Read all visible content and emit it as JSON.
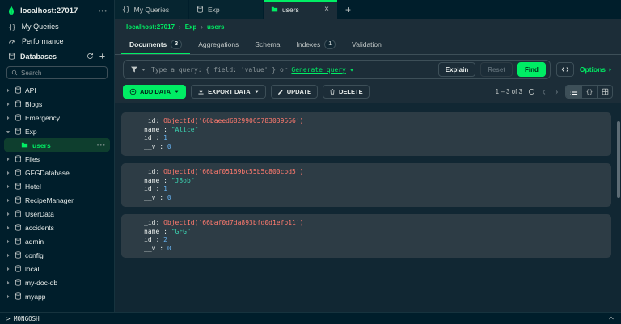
{
  "colors": {
    "accent": "#00ED64",
    "objectid_value": "#FF7A6E",
    "string_value": "#3BD2B0",
    "number_value": "#66B2F0"
  },
  "sidebar": {
    "host": "localhost:27017",
    "menu_dots": "•••",
    "nav": [
      {
        "label": "My Queries"
      },
      {
        "label": "Performance"
      }
    ],
    "databases_label": "Databases",
    "search_placeholder": "Search",
    "databases": [
      {
        "label": "API"
      },
      {
        "label": "Blogs"
      },
      {
        "label": "Emergency"
      },
      {
        "label": "Exp",
        "expanded": true,
        "children": [
          {
            "label": "users",
            "active": true
          }
        ]
      },
      {
        "label": "Files"
      },
      {
        "label": "GFGDatabase"
      },
      {
        "label": "Hotel"
      },
      {
        "label": "RecipeManager"
      },
      {
        "label": "UserData"
      },
      {
        "label": "accidents"
      },
      {
        "label": "admin"
      },
      {
        "label": "config"
      },
      {
        "label": "local"
      },
      {
        "label": "my-doc-db"
      },
      {
        "label": "myapp"
      }
    ]
  },
  "tabbar": {
    "tabs": [
      {
        "label": "My Queries",
        "active": false
      },
      {
        "label": "Exp",
        "active": false
      },
      {
        "label": "users",
        "active": true
      }
    ],
    "new_tab": "+"
  },
  "breadcrumb": {
    "items": [
      "localhost:27017",
      "Exp",
      "users"
    ]
  },
  "subtabs": [
    {
      "label": "Documents",
      "count": "3",
      "active": true
    },
    {
      "label": "Aggregations"
    },
    {
      "label": "Schema"
    },
    {
      "label": "Indexes",
      "count": "1"
    },
    {
      "label": "Validation"
    }
  ],
  "query_bar": {
    "placeholder": "Type a query: { field: 'value' } or",
    "generate_link": "Generate query",
    "explain": "Explain",
    "reset": "Reset",
    "find": "Find",
    "options": "Options"
  },
  "toolbar": {
    "add_data": "ADD DATA",
    "export_data": "EXPORT DATA",
    "update": "UPDATE",
    "delete": "DELETE",
    "pagination": "1 – 3 of 3"
  },
  "documents": [
    {
      "fields": [
        {
          "key": "_id",
          "sep": ": ",
          "value": "ObjectId('66baeed68299065783039666')",
          "type": "objectid"
        },
        {
          "key": "name",
          "sep": " : ",
          "value": "\"Alice\"",
          "type": "string"
        },
        {
          "key": "id",
          "sep": " : ",
          "value": "1",
          "type": "number"
        },
        {
          "key": "__v",
          "sep": " : ",
          "value": "0",
          "type": "number"
        }
      ]
    },
    {
      "fields": [
        {
          "key": "_id",
          "sep": ": ",
          "value": "ObjectId('66baf05169bc55b5c800cbd5')",
          "type": "objectid"
        },
        {
          "key": "name",
          "sep": " : ",
          "value": "\"J8ob\"",
          "type": "string"
        },
        {
          "key": "id",
          "sep": " : ",
          "value": "1",
          "type": "number"
        },
        {
          "key": "__v",
          "sep": " : ",
          "value": "0",
          "type": "number"
        }
      ]
    },
    {
      "fields": [
        {
          "key": "_id",
          "sep": ": ",
          "value": "ObjectId('66baf0d7da893bfd0d1efb11')",
          "type": "objectid"
        },
        {
          "key": "name",
          "sep": " : ",
          "value": "\"GFG\"",
          "type": "string"
        },
        {
          "key": "id",
          "sep": " : ",
          "value": "2",
          "type": "number"
        },
        {
          "key": "__v",
          "sep": " : ",
          "value": "0",
          "type": "number"
        }
      ]
    }
  ],
  "mongosh": {
    "label": ">_MONGOSH"
  }
}
